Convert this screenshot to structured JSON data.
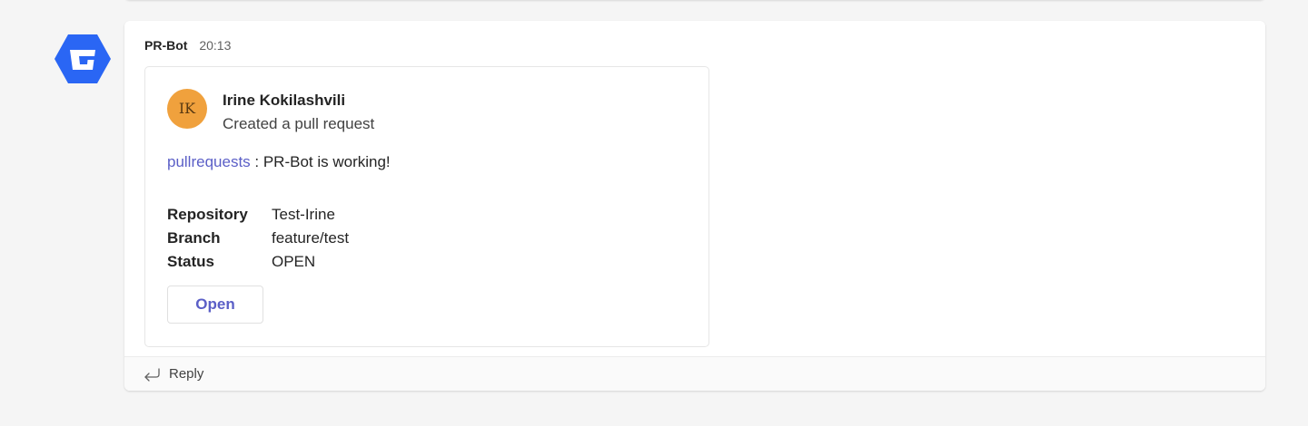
{
  "bot": {
    "avatar_icon": "bitbucket-logo-icon",
    "avatar_color": "#2a66f4"
  },
  "message": {
    "sender": "PR-Bot",
    "timestamp": "20:13"
  },
  "card": {
    "user_initials": "IK",
    "user_avatar_color": "#f0a13d",
    "user_name": "Irine Kokilashvili",
    "action": "Created a pull request",
    "summary_link": "pullrequests",
    "summary_text": " : PR-Bot is working!",
    "facts": [
      {
        "key": "Repository",
        "value": "Test-Irine"
      },
      {
        "key": "Branch",
        "value": "feature/test"
      },
      {
        "key": "Status",
        "value": "OPEN"
      }
    ],
    "open_button_label": "Open",
    "accent_color": "#5b5fc7"
  },
  "reply": {
    "icon": "reply-arrow-icon",
    "label": "Reply"
  }
}
